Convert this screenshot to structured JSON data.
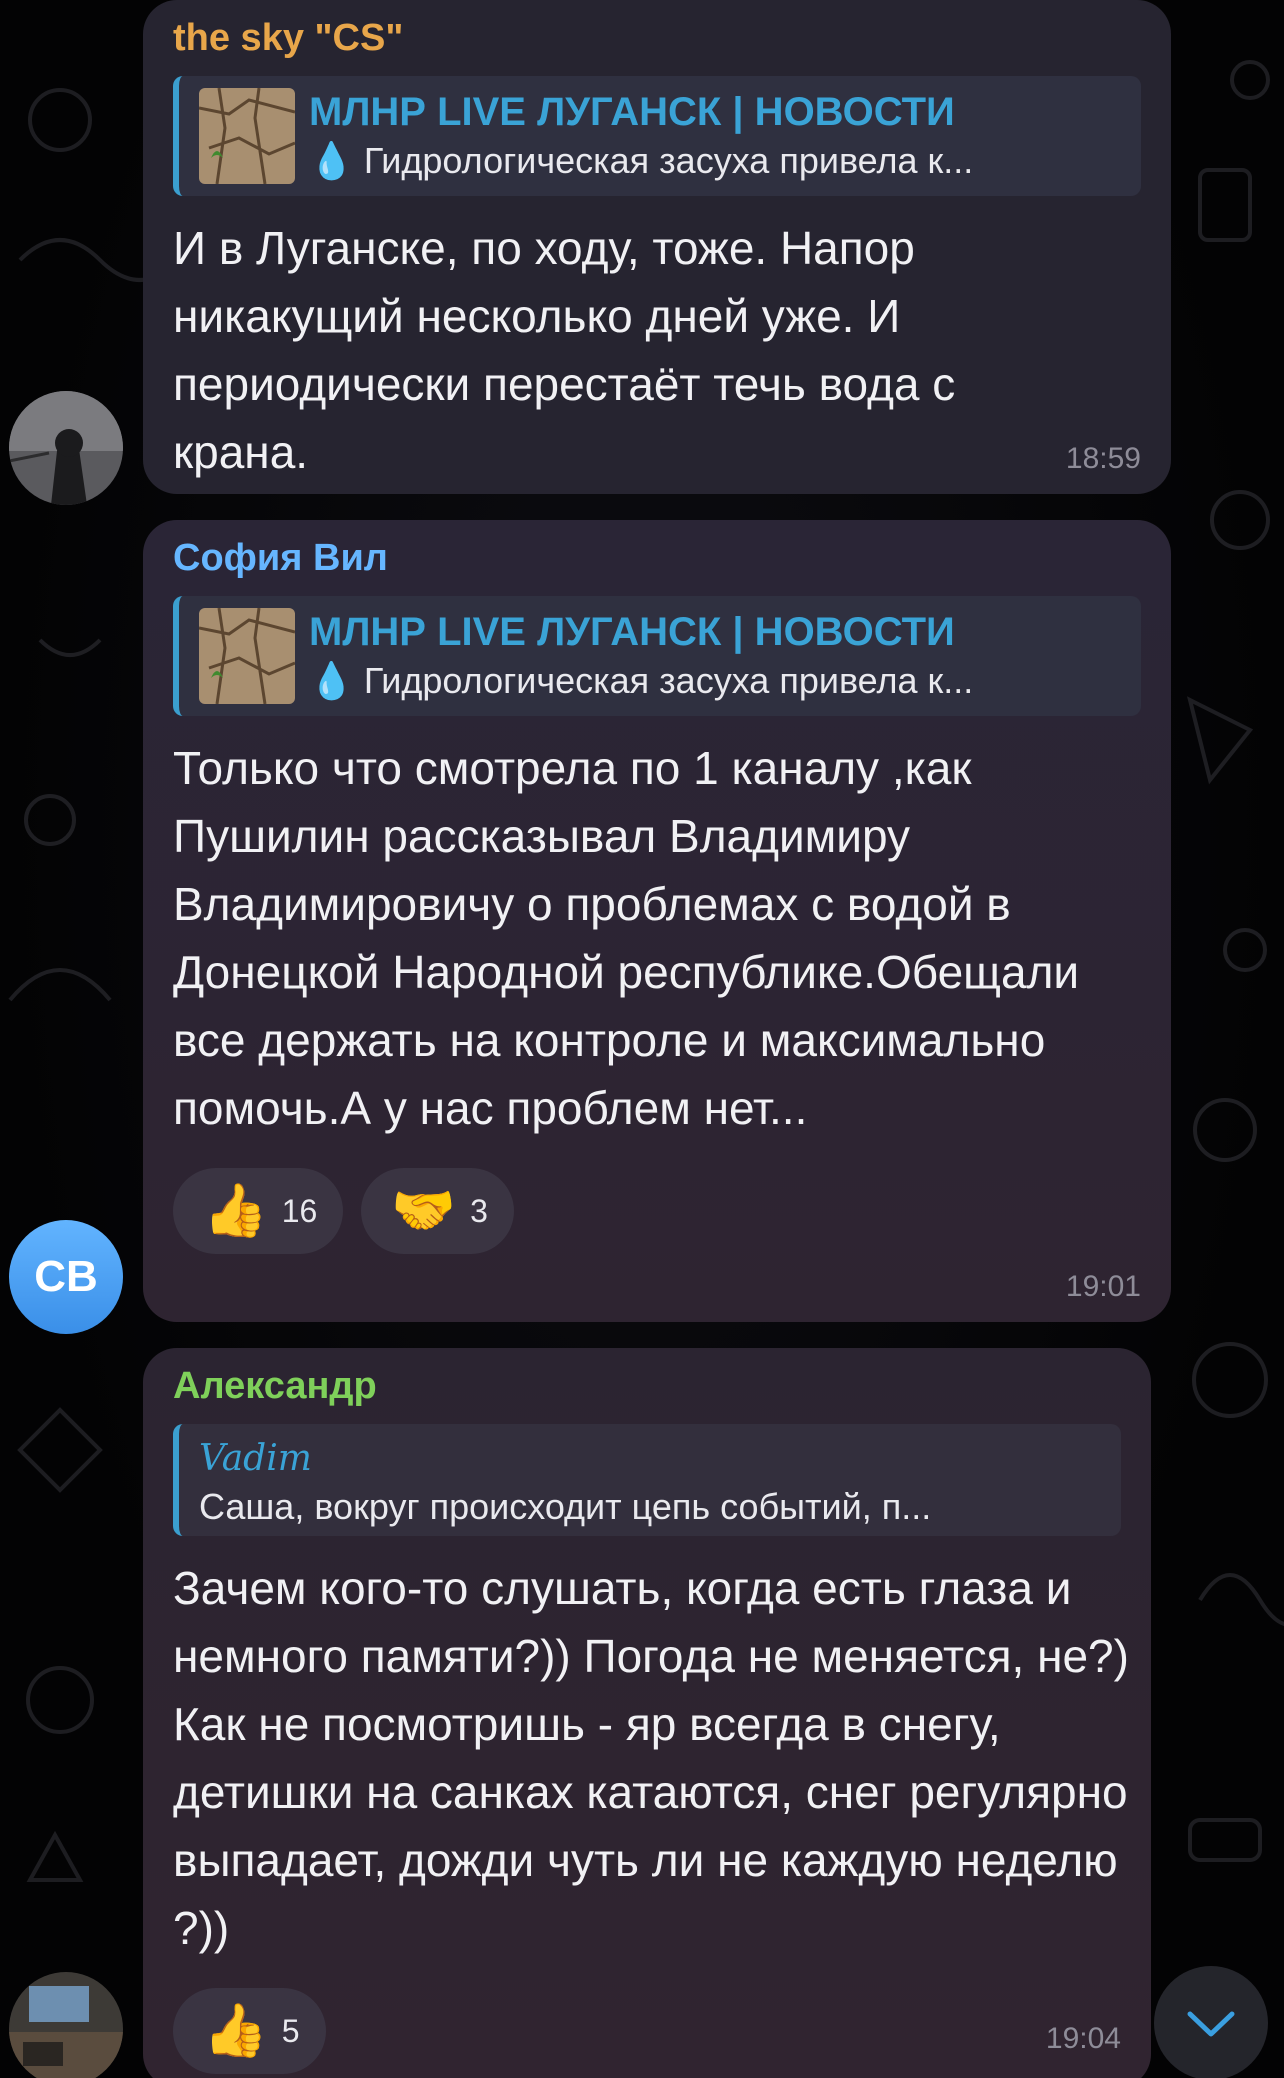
{
  "messages": [
    {
      "sender": "the sky \"CS\"",
      "sender_color": "#e8a64a",
      "reply": {
        "title": "МЛНР LIVE ЛУГАНСК | НОВОСТИ",
        "text": "💧 Гидрологическая засуха привела к..."
      },
      "text": "И в Луганске, по ходу, тоже. Напор никакущий несколько дней уже. И периодически перестаёт течь вода с крана.",
      "time": "18:59",
      "avatar_icon": "hooded-person-photo"
    },
    {
      "sender": "София Вил",
      "sender_color": "#66b6ff",
      "reply": {
        "title": "МЛНР LIVE ЛУГАНСК | НОВОСТИ",
        "text": "💧 Гидрологическая засуха привела к..."
      },
      "text": "Только что смотрела по 1 каналу ,как Пушилин рассказывал Владимиру Владимировичу о проблемах с водой в Донецкой Народной республике.Обещали все держать на контроле и максимально помочь.А у нас проблем нет...",
      "reactions": [
        {
          "emoji": "👍",
          "count": "16"
        },
        {
          "emoji": "🤝",
          "count": "3"
        }
      ],
      "time": "19:01",
      "avatar_initials": "СВ"
    },
    {
      "sender": "Александр",
      "sender_color": "#7fd05a",
      "reply": {
        "title": "Vadim",
        "text": "Саша, вокруг происходит цепь событий, п..."
      },
      "text": "Зачем кого-то слушать, когда есть глаза и немного памяти?)) Погода не меняется, не?) Как не посмотришь - яр всегда в снегу, детишки на санках катаются, снег регулярно выпадает, дожди чуть ли не каждую неделю ?))",
      "reactions": [
        {
          "emoji": "👍",
          "count": "5"
        }
      ],
      "time": "19:04",
      "avatar_icon": "room-photo"
    }
  ],
  "scroll_down_icon": "chevron-down-icon"
}
